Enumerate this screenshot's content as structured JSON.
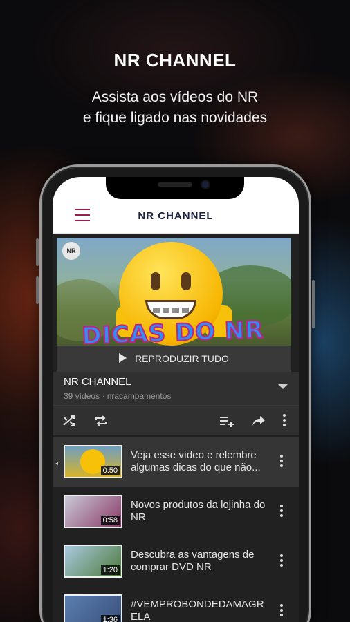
{
  "headline": "NR CHANNEL",
  "subline": [
    "Assista aos vídeos do NR",
    "e fique ligado nas novidades"
  ],
  "app": {
    "title": "NR CHANNEL",
    "menu_icon": "hamburger-menu-icon"
  },
  "hero": {
    "badge": "NR",
    "overlay_text": "DICAS DO NR",
    "play_all_label": "REPRODUZIR TUDO"
  },
  "playlist": {
    "title": "NR CHANNEL",
    "subtitle": "39 vídeos · nracampamentos"
  },
  "toolbar": {
    "shuffle_icon": "shuffle-icon",
    "repeat_icon": "repeat-icon",
    "add_to_queue_icon": "playlist-add-icon",
    "share_icon": "share-icon",
    "more_icon": "more-vertical-icon"
  },
  "videos": [
    {
      "title": "Veja esse vídeo e relembre algumas dicas do que não...",
      "duration": "0:50",
      "thumb_color": "#d8b32a",
      "active": true
    },
    {
      "title": "Novos produtos da lojinha do NR",
      "duration": "0:58",
      "thumb_color": "#8a3a68",
      "active": false
    },
    {
      "title": "Descubra as vantagens de comprar DVD NR",
      "duration": "1:20",
      "thumb_color": "#4d7a3a",
      "active": false
    },
    {
      "title": "#VEMPROBONDEDAMAGR ELA",
      "duration": "1:36",
      "thumb_color": "#3a4f7a",
      "active": false
    }
  ],
  "colors": {
    "accent": "#9b1b53",
    "title_navy": "#1d2240",
    "dark_bg": "#212121",
    "panel_bg": "#303030"
  }
}
